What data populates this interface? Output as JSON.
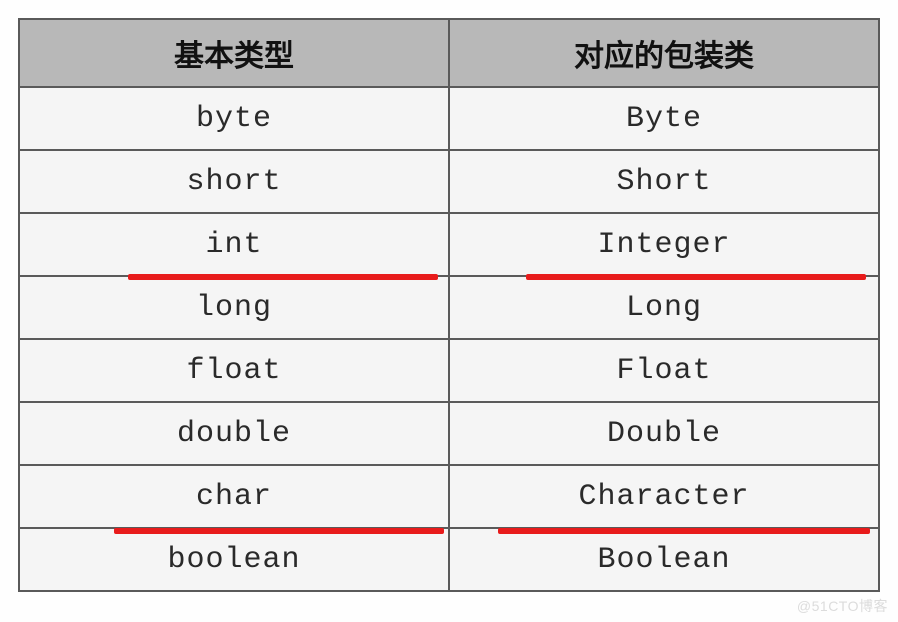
{
  "table": {
    "headers": {
      "col1": "基本类型",
      "col2": "对应的包装类"
    },
    "rows": [
      {
        "primitive": "byte",
        "wrapper": "Byte"
      },
      {
        "primitive": "short",
        "wrapper": "Short"
      },
      {
        "primitive": "int",
        "wrapper": "Integer"
      },
      {
        "primitive": "long",
        "wrapper": "Long"
      },
      {
        "primitive": "float",
        "wrapper": "Float"
      },
      {
        "primitive": "double",
        "wrapper": "Double"
      },
      {
        "primitive": "char",
        "wrapper": "Character"
      },
      {
        "primitive": "boolean",
        "wrapper": "Boolean"
      }
    ]
  },
  "annotations": {
    "underline_color": "#e81b1b",
    "highlighted_rows": [
      2,
      6
    ]
  },
  "watermark": "@51CTO博客"
}
